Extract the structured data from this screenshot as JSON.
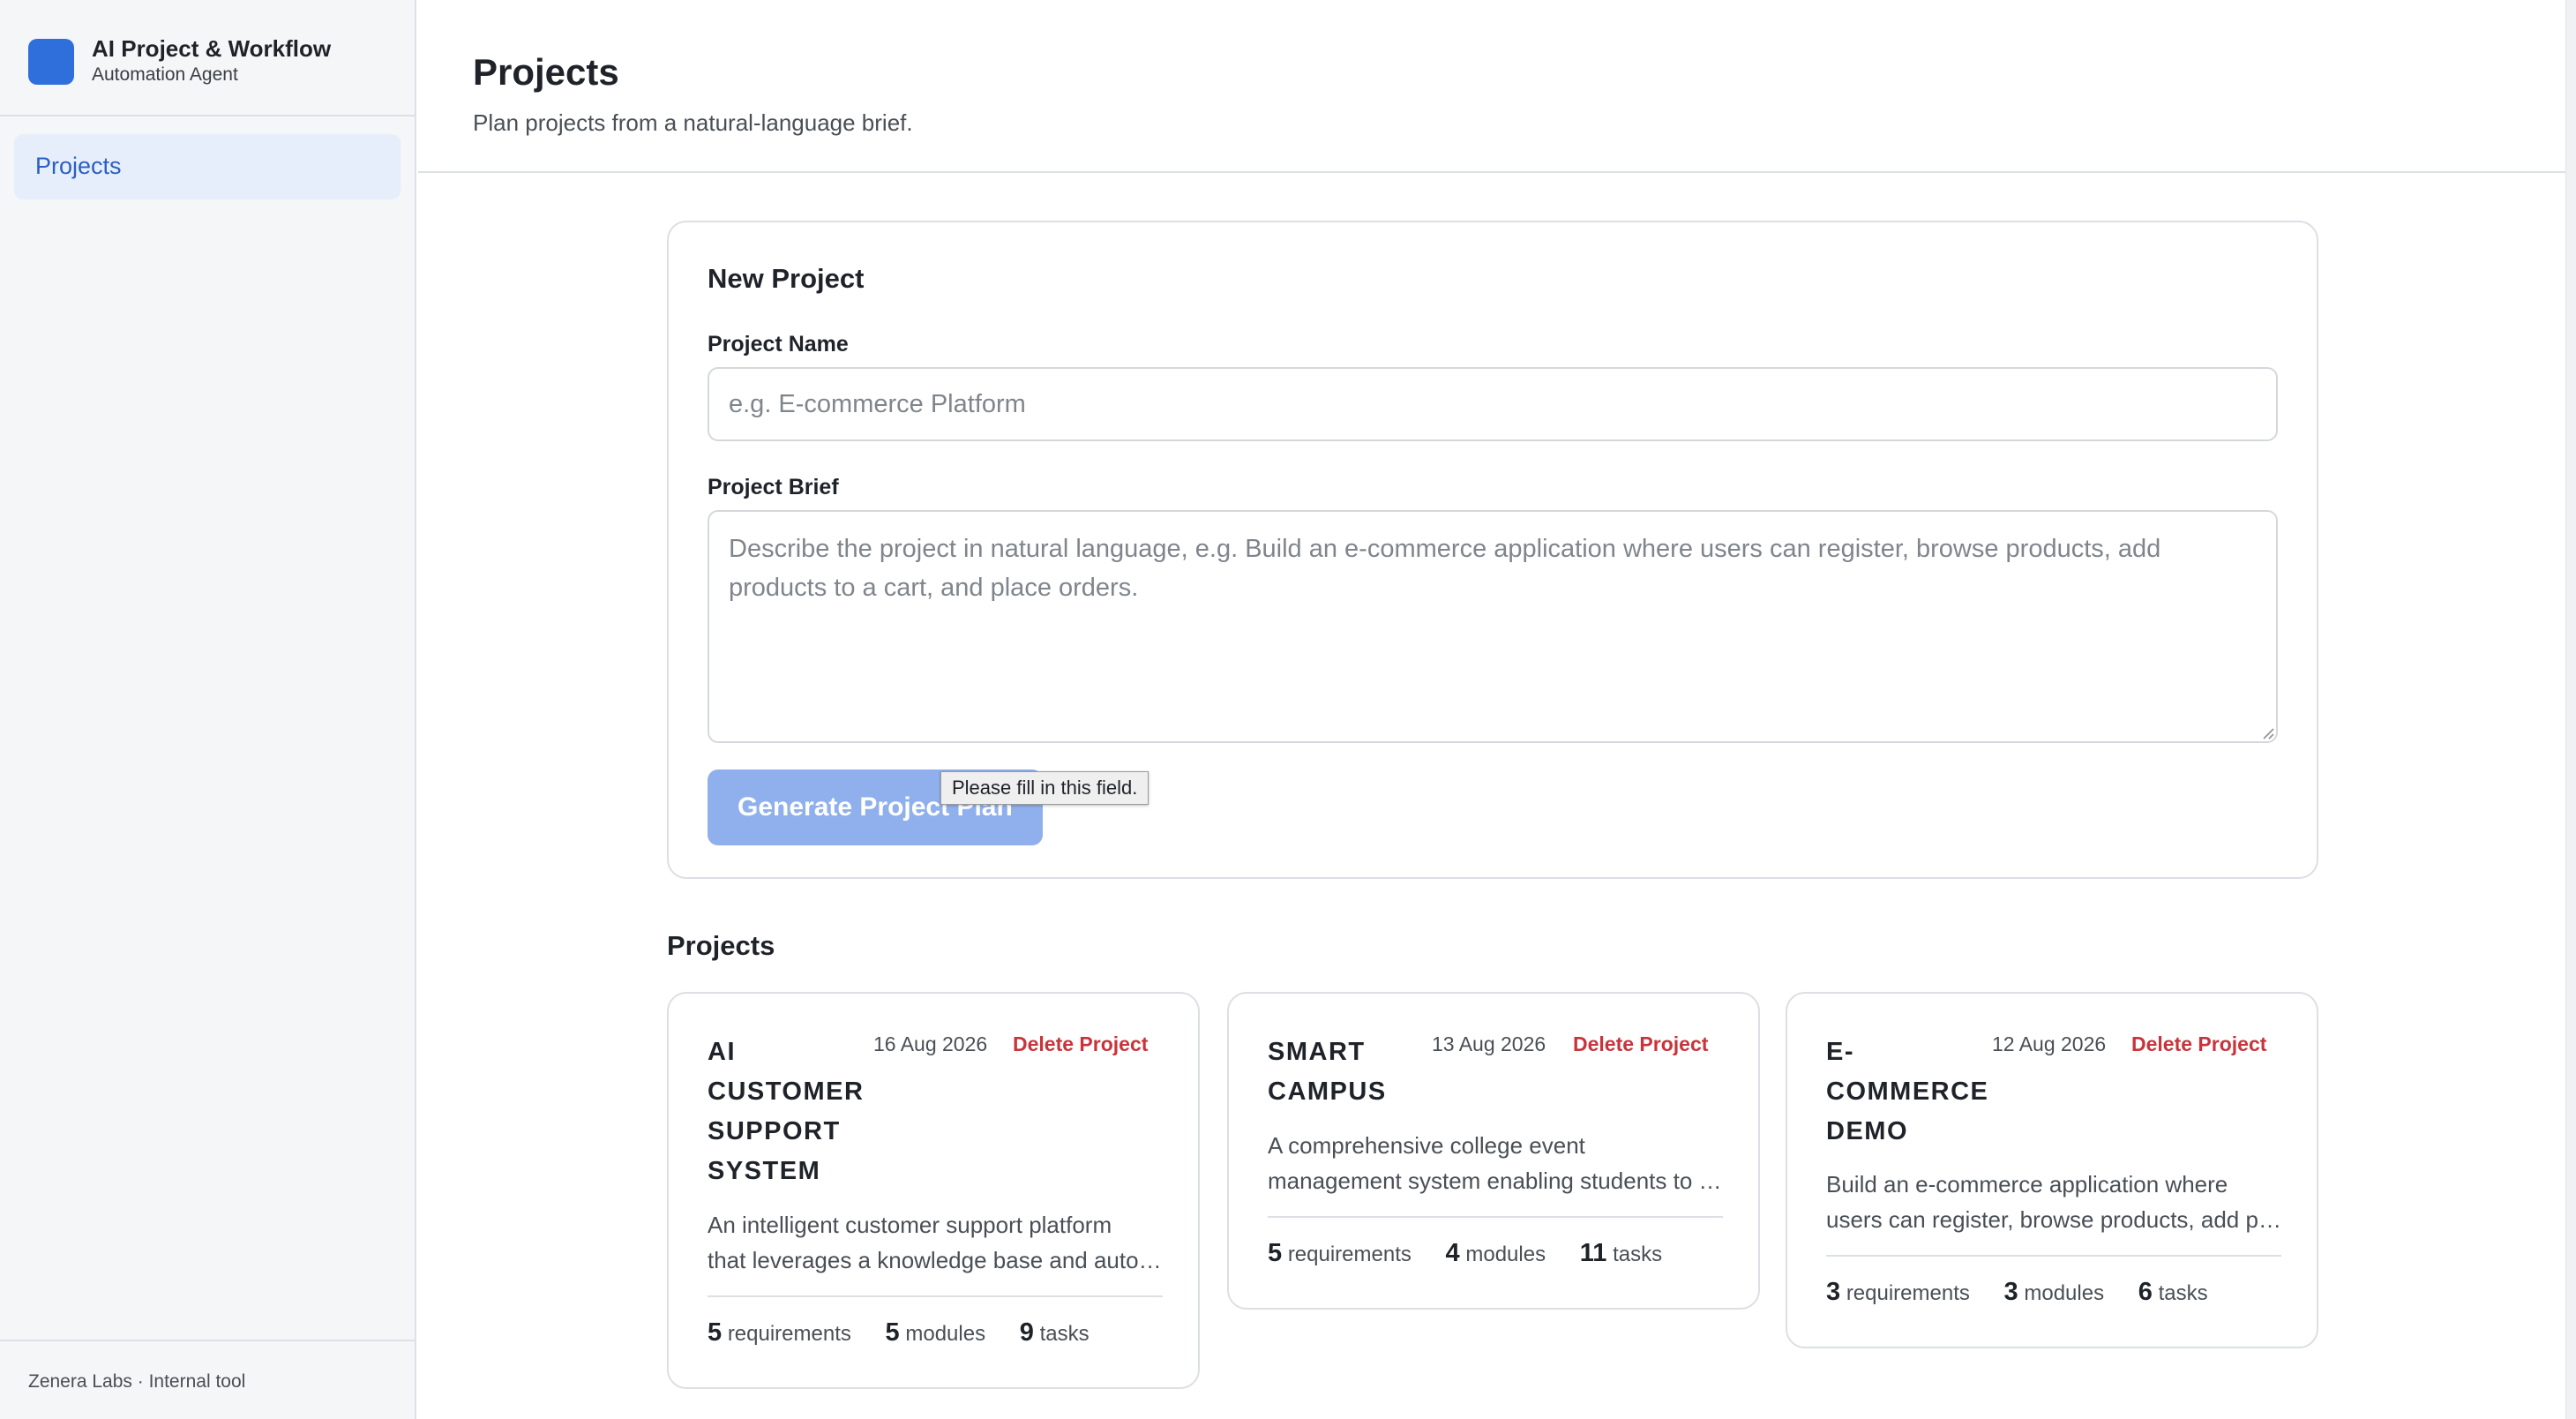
{
  "sidebar": {
    "brand_title": "AI Project & Workflow",
    "brand_subtitle": "Automation Agent",
    "nav_items": [
      {
        "label": "Projects",
        "active": true
      }
    ],
    "footer": "Zenera Labs · Internal tool"
  },
  "header": {
    "title": "Projects",
    "subtitle": "Plan projects from a natural-language brief."
  },
  "new_project": {
    "title": "New Project",
    "name_label": "Project Name",
    "name_placeholder": "e.g. E-commerce Platform",
    "brief_label": "Project Brief",
    "brief_placeholder": "Describe the project in natural language, e.g. Build an e-commerce application where users can register, browse products, add products to a cart, and place orders.",
    "generate_label": "Generate Project Plan",
    "validation_tooltip": "Please fill in this field."
  },
  "projects_section": {
    "title": "Projects",
    "delete_label": "Delete Project",
    "requirements_label": "requirements",
    "modules_label": "modules",
    "tasks_label": "tasks",
    "items": [
      {
        "name_lines": [
          "AI",
          "CUSTOMER",
          "SUPPORT",
          "SYSTEM"
        ],
        "date": "16 Aug 2026",
        "desc_lines": [
          "An intelligent customer support platform",
          "that leverages a knowledge base and automated routing"
        ],
        "requirements": "5",
        "modules": "5",
        "tasks": "9"
      },
      {
        "name_lines": [
          "SMART",
          "CAMPUS"
        ],
        "date": "13 Aug 2026",
        "desc_lines": [
          "A comprehensive college event",
          "management system enabling students to discover events"
        ],
        "requirements": "5",
        "modules": "4",
        "tasks": "11"
      },
      {
        "name_lines": [
          "E-",
          "COMMERCE",
          "DEMO"
        ],
        "date": "12 Aug 2026",
        "desc_lines": [
          "Build an e-commerce application where",
          "users can register, browse products, add products to a cart"
        ],
        "requirements": "3",
        "modules": "3",
        "tasks": "6"
      }
    ]
  },
  "colors": {
    "accent": "#2f6fdc",
    "button_disabled": "#8fb0ec",
    "danger": "#c8343a",
    "sidebar_bg": "#f4f6f8",
    "nav_active_bg": "#e6eefb"
  },
  "icons": {
    "brand_logo": "app-logo-square",
    "resize_grip": "resize-grip-icon"
  }
}
